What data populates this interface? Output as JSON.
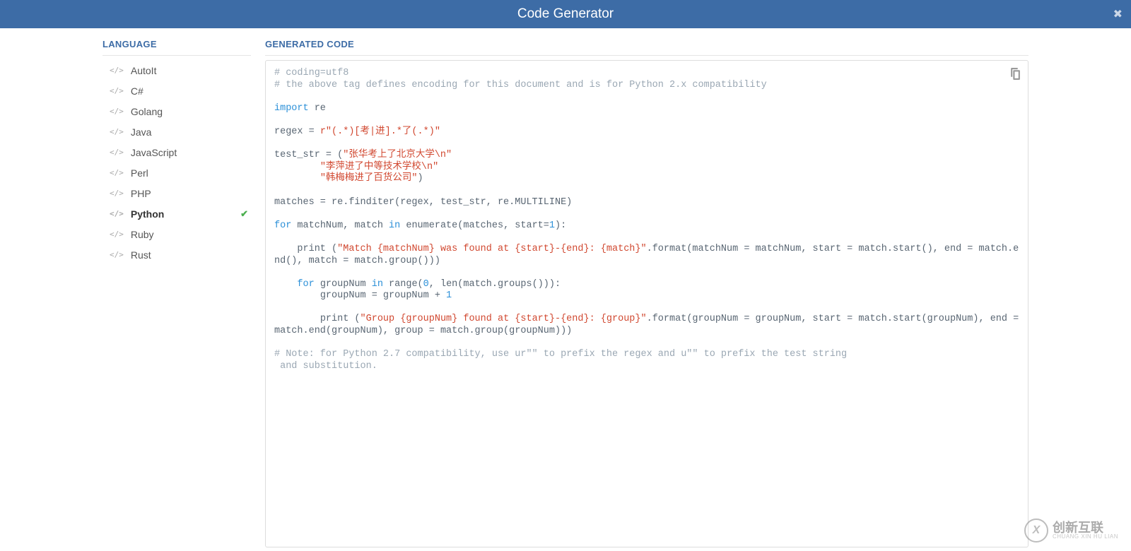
{
  "header": {
    "title": "Code Generator"
  },
  "sidebar": {
    "title": "LANGUAGE",
    "items": [
      {
        "label": "AutoIt",
        "active": false
      },
      {
        "label": "C#",
        "active": false
      },
      {
        "label": "Golang",
        "active": false
      },
      {
        "label": "Java",
        "active": false
      },
      {
        "label": "JavaScript",
        "active": false
      },
      {
        "label": "Perl",
        "active": false
      },
      {
        "label": "PHP",
        "active": false
      },
      {
        "label": "Python",
        "active": true
      },
      {
        "label": "Ruby",
        "active": false
      },
      {
        "label": "Rust",
        "active": false
      }
    ]
  },
  "code": {
    "title": "GENERATED CODE",
    "c1": "# coding=utf8",
    "c2": "# the above tag defines encoding for this document and is for Python 2.x compatibility",
    "kw_import": "import",
    "mod_re": " re",
    "var_regex": "regex = ",
    "regex_str": "r\"(.*)[考|进].*了(.*)\"",
    "test_str_open": "test_str = (",
    "ts1": "\"张华考上了北京大学\\n\"",
    "ts2": "\"李萍进了中等技术学校\\n\"",
    "ts3": "\"韩梅梅进了百货公司\"",
    "test_str_close": ")",
    "matches_line": "matches = re.finditer(regex, test_str, re.MULTILINE)",
    "kw_for": "for",
    "for1_rest": " matchNum, match ",
    "kw_in": "in",
    "for1_enum": " enumerate(matches, start=",
    "num1": "1",
    "for1_close": "):",
    "print1_pre": "    print (",
    "print1_str": "\"Match {matchNum} was found at {start}-{end}: {match}\"",
    "print1_post": ".format(matchNum = matchNum, start = match.start(), end = match.end(), match = match.group()))",
    "for2_pre": "    ",
    "for2_rest": " groupNum ",
    "for2_range": " range(",
    "num0": "0",
    "for2_range2": ", len(match.groups())):",
    "groupnum_line": "        groupNum = groupNum + ",
    "print2_pre": "        print (",
    "print2_str": "\"Group {groupNum} found at {start}-{end}: {group}\"",
    "print2_post": ".format(groupNum = groupNum, start = match.start(groupNum), end = match.end(groupNum), group = match.group(groupNum)))",
    "note_a": "# Note: for Python 2.7 compatibility, use ur\"\" to prefix the regex and u\"\" to prefix the test string",
    "note_b": " and substitution."
  },
  "watermark": {
    "big": "创新互联",
    "small": "CHUANG XIN HU LIAN",
    "logo": "X"
  }
}
